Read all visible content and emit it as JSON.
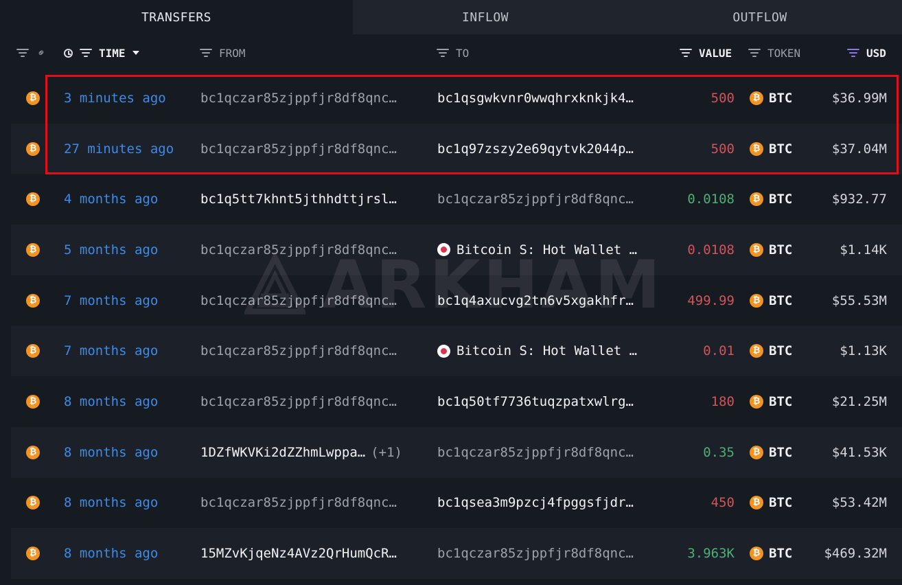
{
  "tabs": [
    {
      "label": "TRANSFERS",
      "active": true
    },
    {
      "label": "INFLOW",
      "active": false
    },
    {
      "label": "OUTFLOW",
      "active": false
    }
  ],
  "columns": {
    "time": "TIME",
    "from": "FROM",
    "to": "TO",
    "value": "VALUE",
    "token": "TOKEN",
    "usd": "USD"
  },
  "watermark": "ARKHAM",
  "colors": {
    "accent_blue": "#3d8be8",
    "value_red": "#d2545a",
    "value_green": "#4fae77",
    "btc_orange": "#f39321",
    "highlight_red": "#e0101a"
  },
  "rows": [
    {
      "time": "3 minutes ago",
      "from": "bc1qczar85zjppfjr8df8qnc…",
      "from_extra": "",
      "from_strong": false,
      "to": "bc1qsgwkvnr0wwqhrxknkjk4…",
      "to_strong": true,
      "to_entity": false,
      "value": "500",
      "value_color": "red",
      "token": "BTC",
      "usd": "$36.99M"
    },
    {
      "time": "27 minutes ago",
      "from": "bc1qczar85zjppfjr8df8qnc…",
      "from_extra": "",
      "from_strong": false,
      "to": "bc1q97zszy2e69qytvk2044p…",
      "to_strong": true,
      "to_entity": false,
      "value": "500",
      "value_color": "red",
      "token": "BTC",
      "usd": "$37.04M"
    },
    {
      "time": "4 months ago",
      "from": "bc1q5tt7khnt5jthhdttjrsl…",
      "from_extra": "",
      "from_strong": true,
      "to": "bc1qczar85zjppfjr8df8qnc…",
      "to_strong": false,
      "to_entity": false,
      "value": "0.0108",
      "value_color": "green",
      "token": "BTC",
      "usd": "$932.77"
    },
    {
      "time": "5 months ago",
      "from": "bc1qczar85zjppfjr8df8qnc…",
      "from_extra": "",
      "from_strong": false,
      "to": "Bitcoin S: Hot Wallet …",
      "to_strong": true,
      "to_entity": true,
      "value": "0.0108",
      "value_color": "red",
      "token": "BTC",
      "usd": "$1.14K"
    },
    {
      "time": "7 months ago",
      "from": "bc1qczar85zjppfjr8df8qnc…",
      "from_extra": "",
      "from_strong": false,
      "to": "bc1q4axucvg2tn6v5xgakhfr…",
      "to_strong": true,
      "to_entity": false,
      "value": "499.99",
      "value_color": "red",
      "token": "BTC",
      "usd": "$55.53M"
    },
    {
      "time": "7 months ago",
      "from": "bc1qczar85zjppfjr8df8qnc…",
      "from_extra": "",
      "from_strong": false,
      "to": "Bitcoin S: Hot Wallet …",
      "to_strong": true,
      "to_entity": true,
      "value": "0.01",
      "value_color": "red",
      "token": "BTC",
      "usd": "$1.13K"
    },
    {
      "time": "8 months ago",
      "from": "bc1qczar85zjppfjr8df8qnc…",
      "from_extra": "",
      "from_strong": false,
      "to": "bc1q50tf7736tuqzpatxwlrg…",
      "to_strong": true,
      "to_entity": false,
      "value": "180",
      "value_color": "red",
      "token": "BTC",
      "usd": "$21.25M"
    },
    {
      "time": "8 months ago",
      "from": "1DZfWKVKi2dZZhmLwppa…",
      "from_extra": "(+1)",
      "from_strong": true,
      "to": "bc1qczar85zjppfjr8df8qnc…",
      "to_strong": false,
      "to_entity": false,
      "value": "0.35",
      "value_color": "green",
      "token": "BTC",
      "usd": "$41.53K"
    },
    {
      "time": "8 months ago",
      "from": "bc1qczar85zjppfjr8df8qnc…",
      "from_extra": "",
      "from_strong": false,
      "to": "bc1qsea3m9pzcj4fpggsfjdr…",
      "to_strong": true,
      "to_entity": false,
      "value": "450",
      "value_color": "red",
      "token": "BTC",
      "usd": "$53.42M"
    },
    {
      "time": "8 months ago",
      "from": "15MZvKjqeNz4AVz2QrHumQcR…",
      "from_extra": "",
      "from_strong": true,
      "to": "bc1qczar85zjppfjr8df8qnc…",
      "to_strong": false,
      "to_entity": false,
      "value": "3.963K",
      "value_color": "green",
      "token": "BTC",
      "usd": "$469.32M"
    }
  ]
}
